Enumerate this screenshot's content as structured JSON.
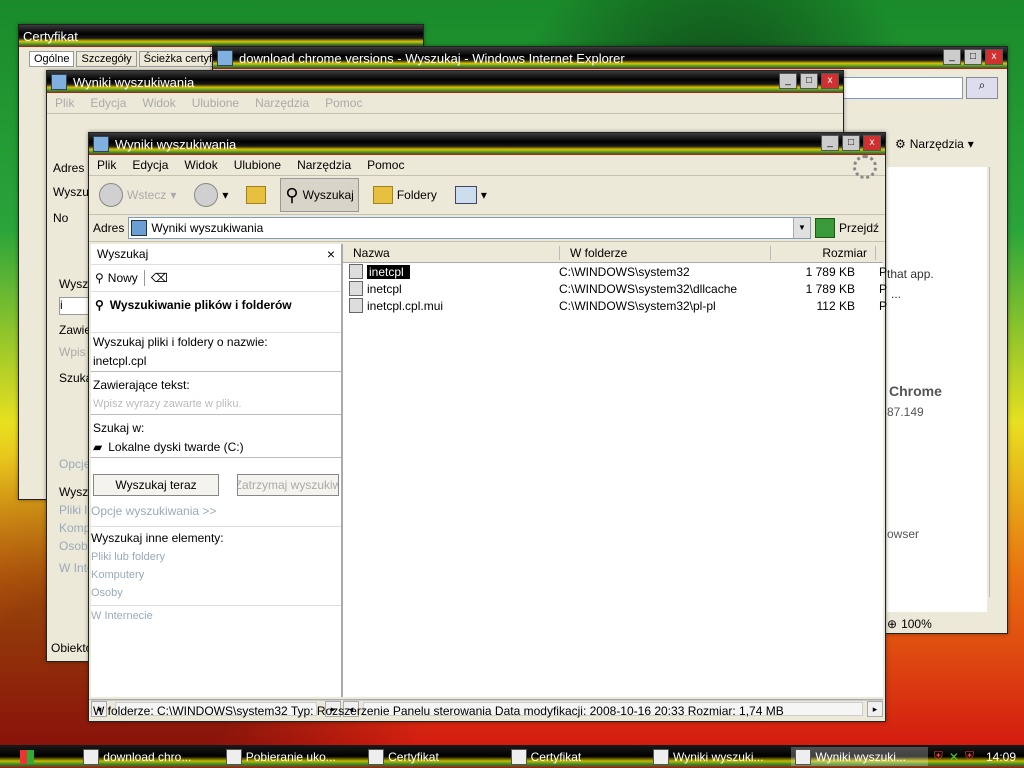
{
  "taskbar": {
    "items": [
      {
        "label": "download chro..."
      },
      {
        "label": "Pobieranie uko..."
      },
      {
        "label": "Certyfikat"
      },
      {
        "label": "Certyfikat"
      },
      {
        "label": "Wyniki wyszuki..."
      },
      {
        "label": "Wyniki wyszuki..."
      }
    ],
    "clock": "14:09"
  },
  "cert_window": {
    "title": "Certyfikat",
    "tabs": [
      "Ogólne",
      "Szczegóły",
      "Ścieżka certyfi"
    ]
  },
  "ie_window": {
    "title": "download chrome versions - Wyszukaj - Windows Internet Explorer",
    "tools_label": "Narzędzia",
    "snippets": [
      "that app.",
      "...",
      "Chrome",
      "87.149",
      "owser"
    ],
    "zoom": "100%"
  },
  "back_search": {
    "title": "Wyniki wyszukiwania",
    "menu": [
      "Plik",
      "Edycja",
      "Widok",
      "Ulubione",
      "Narzędzia",
      "Pomoc"
    ],
    "addr_label": "Adres",
    "fragments": [
      "Wyszu",
      "No",
      "W",
      "Wyszu",
      "i",
      "Zawie",
      "Wpis",
      "Szuka",
      "L",
      "Opcje",
      "Wyszu",
      "Pliki l",
      "Kompu",
      "Osoby",
      "W Inte",
      "Obiektó"
    ]
  },
  "main": {
    "title": "Wyniki wyszukiwania",
    "menu": [
      "Plik",
      "Edycja",
      "Widok",
      "Ulubione",
      "Narzędzia",
      "Pomoc"
    ],
    "toolbar": {
      "back": "Wstecz",
      "search": "Wyszukaj",
      "folders": "Foldery"
    },
    "address": {
      "label": "Adres",
      "value": "Wyniki wyszukiwania",
      "go": "Przejdź"
    },
    "search_pane": {
      "title": "Wyszukaj",
      "new": "Nowy",
      "heading": "Wyszukiwanie plików i folderów",
      "name_label": "Wyszukaj pliki i foldery o nazwie:",
      "name_value": "inetcpl.cpl",
      "text_label": "Zawierające tekst:",
      "text_placeholder": "Wpisz wyrazy zawarte w pliku.",
      "location_label": "Szukaj w:",
      "location_value": "Lokalne dyski twarde (C:)",
      "search_btn": "Wyszukaj teraz",
      "stop_btn": "Zatrzymaj wyszukiw",
      "options": "Opcje wyszukiwania >>",
      "other_label": "Wyszukaj inne elementy:",
      "other_links": [
        "Pliki lub foldery",
        "Komputery",
        "Osoby"
      ],
      "internet": "W Internecie"
    },
    "columns": [
      "Nazwa",
      "W folderze",
      "Rozmiar"
    ],
    "files": [
      {
        "name": "inetcpl",
        "folder": "C:\\WINDOWS\\system32",
        "size": "1 789 KB",
        "extra": "P"
      },
      {
        "name": "inetcpl",
        "folder": "C:\\WINDOWS\\system32\\dllcache",
        "size": "1 789 KB",
        "extra": "P"
      },
      {
        "name": "inetcpl.cpl.mui",
        "folder": "C:\\WINDOWS\\system32\\pl-pl",
        "size": "112 KB",
        "extra": "P"
      }
    ],
    "status": "W folderze: C:\\WINDOWS\\system32 Typ: Rozszerzenie Panelu sterowania Data modyfikacji: 2008-10-16 20:33 Rozmiar: 1,74 MB"
  },
  "colors": {
    "selection": "#000000",
    "titlebar": "#000000",
    "link_disabled": "#99aabb"
  }
}
